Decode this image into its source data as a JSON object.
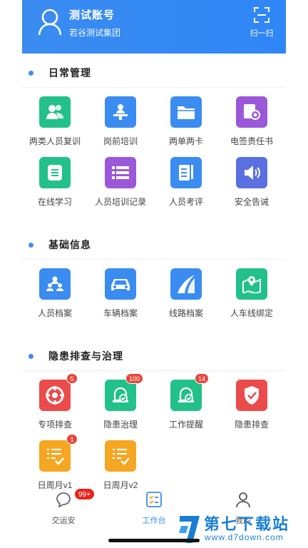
{
  "header": {
    "account_name": "测试账号",
    "org_name": "若谷测试集团",
    "scan_label": "扫一扫"
  },
  "sections": {
    "daily": {
      "title": "日常管理",
      "items": [
        {
          "label": "两类人员复训",
          "icon": "people-icon",
          "color": "#22c18a"
        },
        {
          "label": "岗前培训",
          "icon": "presenter-icon",
          "color": "#3a8cf0"
        },
        {
          "label": "两单两卡",
          "icon": "folder-icon",
          "color": "#3a8cf0"
        },
        {
          "label": "电签责任书",
          "icon": "certificate-icon",
          "color": "#9b59d9"
        },
        {
          "label": "在线学习",
          "icon": "list-doc-icon",
          "color": "#22c18a"
        },
        {
          "label": "人员培训记录",
          "icon": "list-icon",
          "color": "#9b59d9"
        },
        {
          "label": "人员考评",
          "icon": "notebook-icon",
          "color": "#3a8cf0"
        },
        {
          "label": "安全告诫",
          "icon": "speaker-icon",
          "color": "#5a6fe0"
        }
      ]
    },
    "basic": {
      "title": "基础信息",
      "items": [
        {
          "label": "人员档案",
          "icon": "staff-icon",
          "color": "#3a8cf0"
        },
        {
          "label": "车辆档案",
          "icon": "car-icon",
          "color": "#3a8cf0"
        },
        {
          "label": "线路档案",
          "icon": "road-icon",
          "color": "#3a8cf0"
        },
        {
          "label": "人车线绑定",
          "icon": "map-pin-icon",
          "color": "#22c18a"
        }
      ]
    },
    "hazard": {
      "title": "隐患排查与治理",
      "items": [
        {
          "label": "专项排查",
          "icon": "target-icon",
          "color": "#ec4b4b",
          "badge": "5"
        },
        {
          "label": "隐患治理",
          "icon": "bell-check-icon",
          "color": "#22c18a",
          "badge": "100"
        },
        {
          "label": "工作提醒",
          "icon": "bell-check-icon",
          "color": "#22c18a",
          "badge": "14"
        },
        {
          "label": "隐患排查",
          "icon": "shield-check-icon",
          "color": "#ec4b4b"
        },
        {
          "label": "日周月v1",
          "icon": "checklist-icon",
          "color": "#f5a623",
          "badge": "1"
        },
        {
          "label": "日周月v2",
          "icon": "checklist-icon",
          "color": "#f5a623"
        }
      ]
    }
  },
  "tabbar": {
    "tabs": [
      {
        "label": "交运安",
        "badge": "99+"
      },
      {
        "label": "工作台"
      },
      {
        "label": "我的"
      }
    ]
  },
  "watermark": {
    "text": "第七下载站",
    "url": "www.d7down.com"
  }
}
